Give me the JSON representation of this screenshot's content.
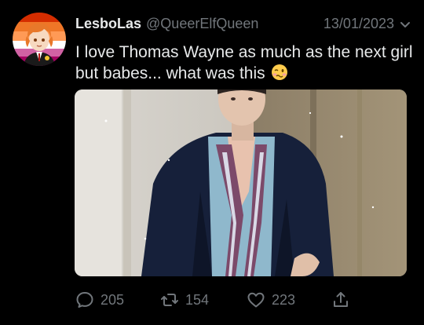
{
  "tweet": {
    "display_name": "LesboLas",
    "handle": "@QueerElfQueen",
    "date": "13/01/2023",
    "text": "I love Thomas Wayne as much as the next girl but babes... what was this",
    "emoji": "woozy-face-icon"
  },
  "actions": {
    "replies": "205",
    "retweets": "154",
    "likes": "223"
  },
  "colors": {
    "background": "#000000",
    "text": "#e7e9ea",
    "muted": "#71767b"
  },
  "icons": [
    "reply-icon",
    "retweet-icon",
    "like-icon",
    "share-icon",
    "chevron-down-icon"
  ]
}
